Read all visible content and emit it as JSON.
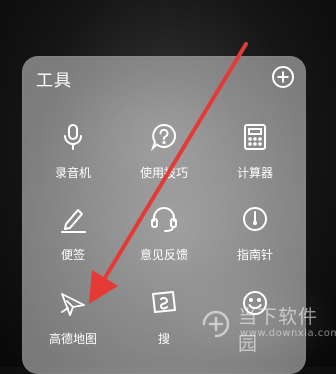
{
  "panel": {
    "title": "工具"
  },
  "tools": [
    {
      "label": "录音机",
      "icon": "microphone-icon"
    },
    {
      "label": "使用技巧",
      "icon": "help-bubble-icon"
    },
    {
      "label": "计算器",
      "icon": "calculator-icon"
    },
    {
      "label": "便签",
      "icon": "note-pencil-icon"
    },
    {
      "label": "意见反馈",
      "icon": "feedback-headset-icon"
    },
    {
      "label": "指南针",
      "icon": "compass-icon"
    },
    {
      "label": "高德地图",
      "icon": "map-plane-icon"
    },
    {
      "label": "搜",
      "icon": "search-card-icon"
    },
    {
      "label": "",
      "icon": "smiley-icon"
    }
  ],
  "watermark": {
    "text": "当下软件园",
    "url": "www.downxia.com"
  },
  "colors": {
    "arrow": "#e53935",
    "panel": "#cdcdcd",
    "text": "#ffffff"
  }
}
